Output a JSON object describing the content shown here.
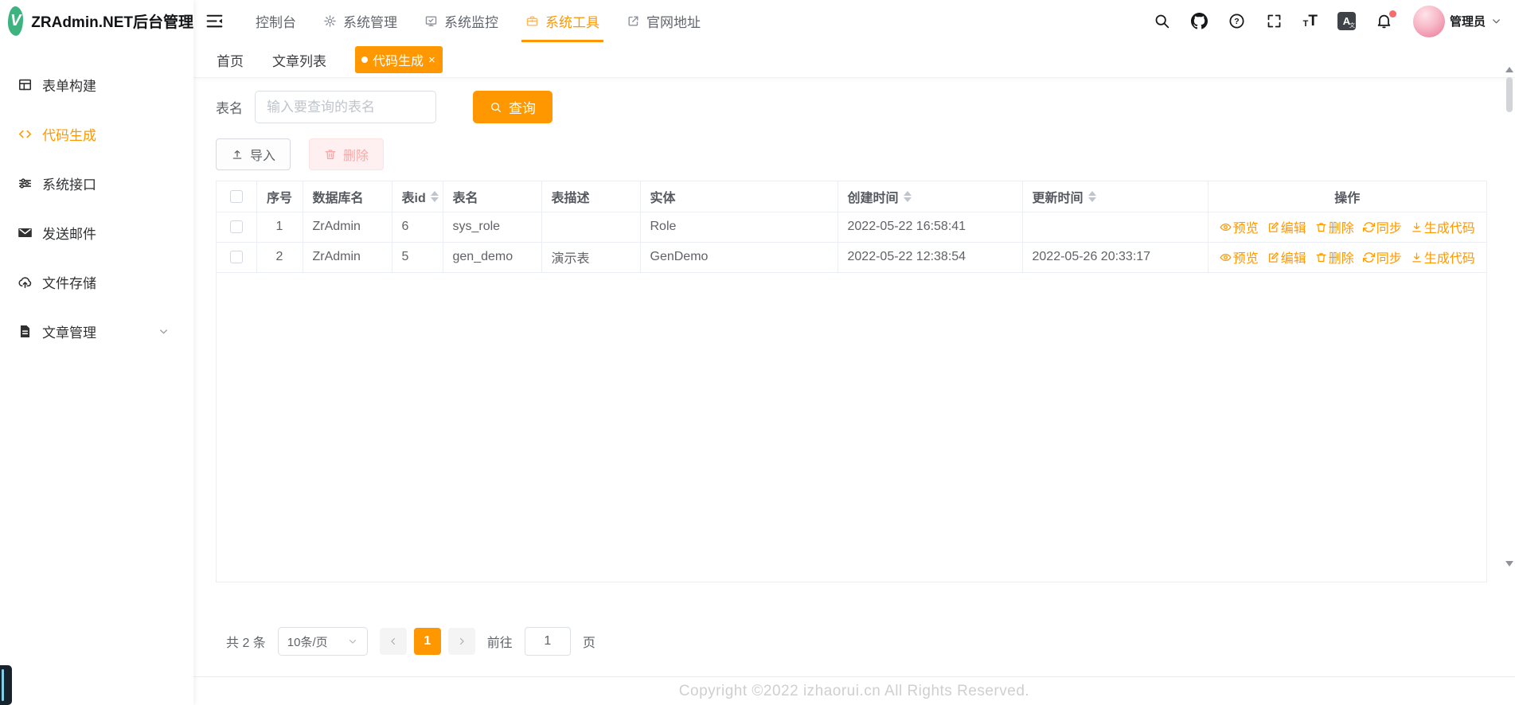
{
  "app": {
    "title": "ZRAdmin.NET后台管理",
    "logo_letter": "V"
  },
  "colors": {
    "accent": "#ff9800",
    "logo_green": "#3db380",
    "danger_dot": "#f56c6c"
  },
  "header": {
    "nav": [
      {
        "label": "控制台"
      },
      {
        "label": "系统管理"
      },
      {
        "label": "系统监控"
      },
      {
        "label": "系统工具"
      },
      {
        "label": "官网地址"
      }
    ],
    "active_nav": "系统工具",
    "tools": {
      "help_mark": "?",
      "font_small": "T",
      "font_big": "T",
      "language_glyph": "A",
      "language_sub": "文"
    },
    "user": {
      "name": "管理员"
    }
  },
  "sidebar": {
    "items": [
      {
        "label": "表单构建"
      },
      {
        "label": "代码生成"
      },
      {
        "label": "系统接口"
      },
      {
        "label": "发送邮件"
      },
      {
        "label": "文件存储"
      },
      {
        "label": "文章管理"
      }
    ],
    "active_item": "代码生成"
  },
  "tabs": [
    {
      "label": "首页"
    },
    {
      "label": "文章列表"
    },
    {
      "label": "代码生成",
      "close": "×"
    }
  ],
  "active_tab": "代码生成",
  "search": {
    "label": "表名",
    "placeholder": "输入要查询的表名",
    "button_label": "查询"
  },
  "toolbar": {
    "import_label": "导入",
    "delete_label": "删除"
  },
  "table": {
    "columns": [
      "序号",
      "数据库名",
      "表id",
      "表名",
      "表描述",
      "实体",
      "创建时间",
      "更新时间",
      "操作"
    ],
    "sortable_columns": [
      "表id",
      "创建时间",
      "更新时间"
    ],
    "rows": [
      {
        "num": "1",
        "db": "ZrAdmin",
        "tid": "6",
        "name": "sys_role",
        "desc": "",
        "entity": "Role",
        "created": "2022-05-22 16:58:41",
        "updated": ""
      },
      {
        "num": "2",
        "db": "ZrAdmin",
        "tid": "5",
        "name": "gen_demo",
        "desc": "演示表",
        "entity": "GenDemo",
        "created": "2022-05-22 12:38:54",
        "updated": "2022-05-26 20:33:17"
      }
    ],
    "action_labels": [
      "预览",
      "编辑",
      "删除",
      "同步",
      "生成代码"
    ]
  },
  "pagination": {
    "total_text": "共 2 条",
    "page_size_text": "10条/页",
    "current_page": "1",
    "goto_label": "前往",
    "goto_value": "1",
    "unit_label": "页"
  },
  "footer": {
    "copyright": "Copyright ©2022 izhaorui.cn All Rights Reserved."
  }
}
